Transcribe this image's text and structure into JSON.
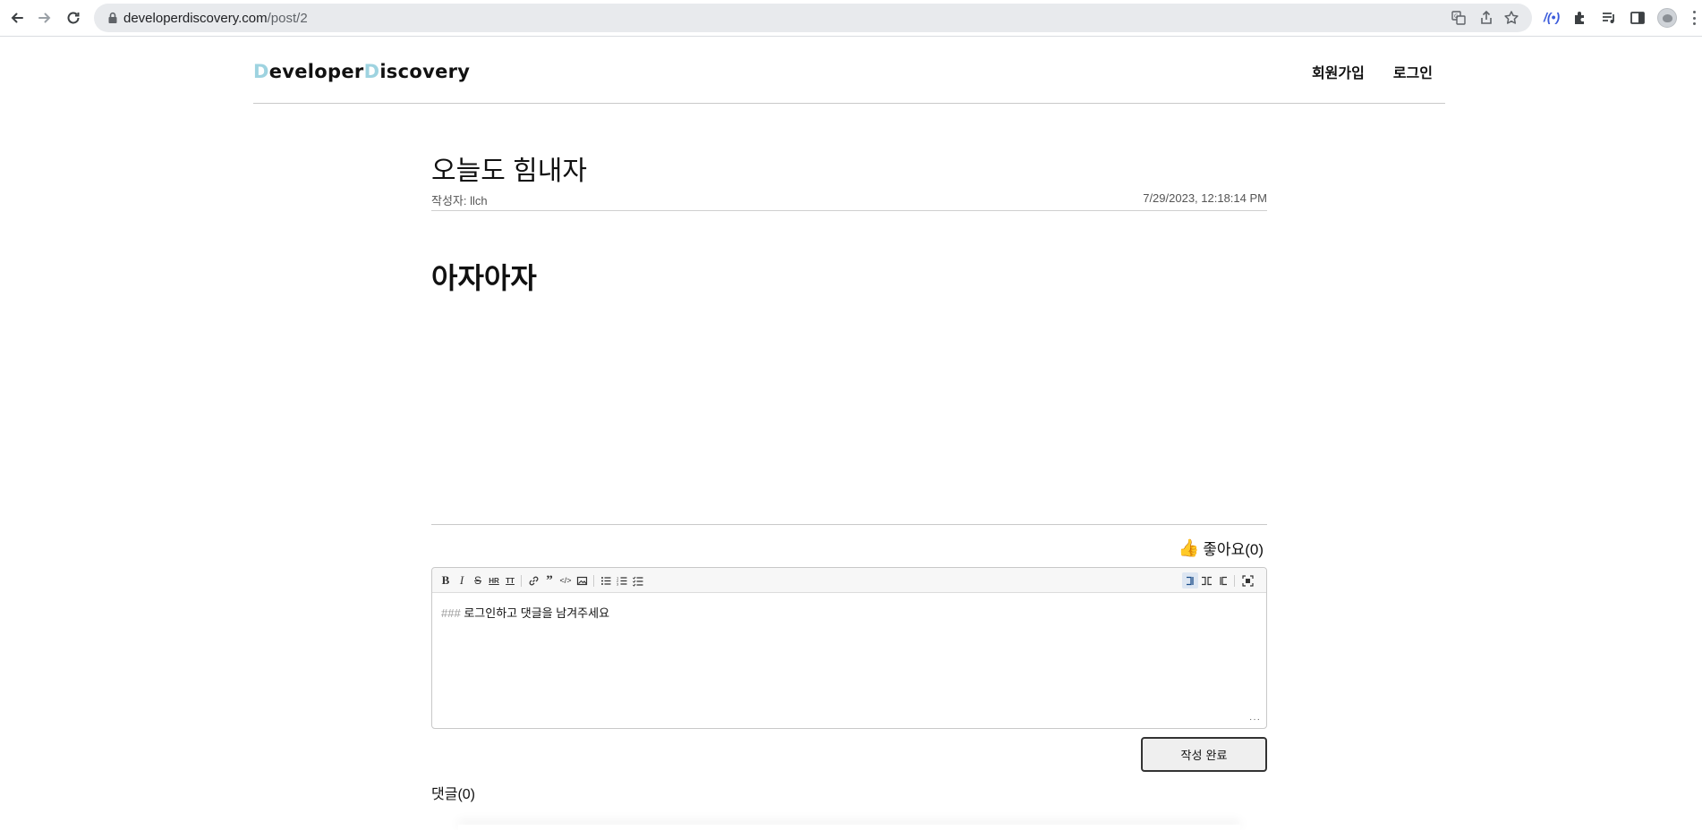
{
  "browser": {
    "url_host": "developerdiscovery.com",
    "url_path": "/post/2"
  },
  "site": {
    "logo_d1": "D",
    "logo_part1": "eveloper",
    "logo_d2": "D",
    "logo_part2": "iscovery",
    "accent_color": "#9ed3e0",
    "nav": {
      "signup": "회원가입",
      "login": "로그인"
    }
  },
  "post": {
    "title": "오늘도 힘내자",
    "author_label": "작성자: llch",
    "date": "7/29/2023, 12:18:14 PM",
    "body_heading": "아자아자",
    "like_label": "좋아요(0)",
    "like_icon": "thumbs-up-icon"
  },
  "editor": {
    "toolbar": [
      "bold-icon",
      "italic-icon",
      "strikethrough-icon",
      "hr-icon",
      "heading-icon",
      "link-icon",
      "quote-icon",
      "code-icon",
      "image-icon",
      "bullet-list-icon",
      "numbered-list-icon",
      "checklist-icon",
      "edit-mode-icon",
      "live-mode-icon",
      "preview-mode-icon",
      "fullscreen-icon"
    ],
    "markdown_prefix": "###",
    "text": "로그인하고 댓글을 남겨주세요",
    "submit_label": "작성 완료"
  },
  "comments": {
    "title": "댓글(0)"
  }
}
